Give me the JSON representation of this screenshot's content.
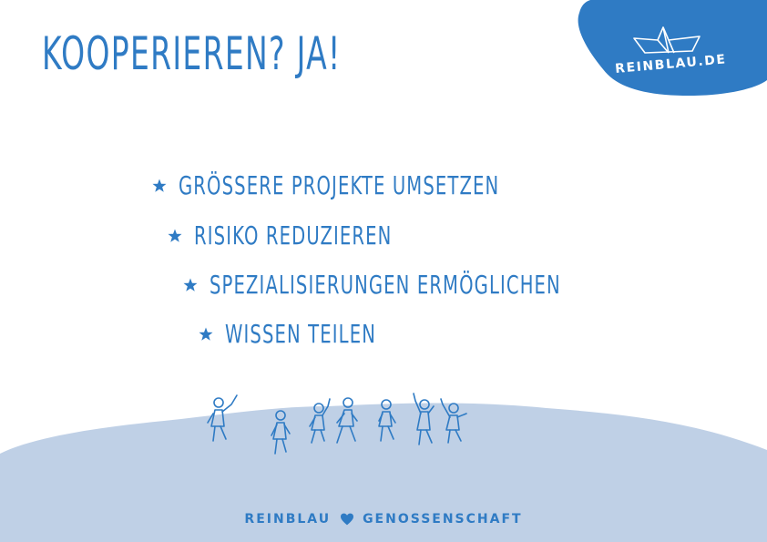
{
  "title": "KOOPERIEREN? JA!",
  "badge": {
    "label": "REINBLAU.DE",
    "icon": "paper-boat-icon"
  },
  "list": [
    {
      "text": "GRÖSSERE PROJEKTE UMSETZEN",
      "icon": "star-icon"
    },
    {
      "text": "RISIKO REDUZIEREN",
      "icon": "star-icon"
    },
    {
      "text": "SPEZIALISIERUNGEN ERMÖGLICHEN",
      "icon": "star-icon"
    },
    {
      "text": "WISSEN TEILEN",
      "icon": "star-icon"
    }
  ],
  "footer": {
    "left": "REINBLAU",
    "right": "GENOSSENSCHAFT",
    "icon": "heart-icon"
  },
  "colors": {
    "accent": "#2f7bc4",
    "hill": "#bfd0e6",
    "background": "#ffffff"
  }
}
